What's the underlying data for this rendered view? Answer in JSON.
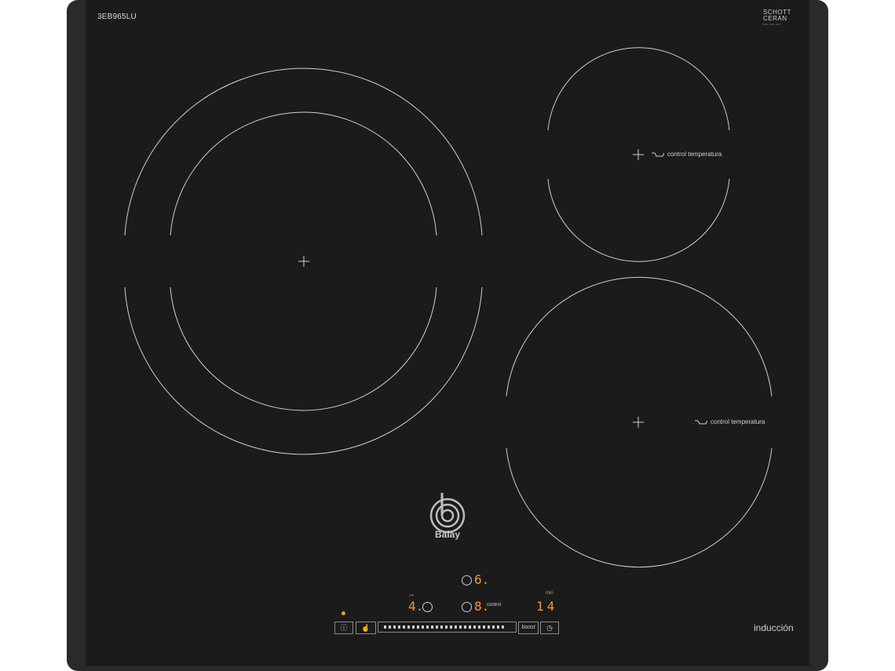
{
  "header": {
    "model": "3EB965LU"
  },
  "glass_brand": {
    "line1": "SCHOTT",
    "line2": "CERAN",
    "fine_print": "800-000-000"
  },
  "footer": {
    "type_label": "inducción"
  },
  "zones": {
    "large": {
      "name": "left"
    },
    "top_right": {
      "label": "control temperatura"
    },
    "bottom_right": {
      "label": "control temperatura"
    }
  },
  "brand": {
    "name": "Balay"
  },
  "panel": {
    "zone_top_level": "6.",
    "zone_left_level": "4.",
    "zone_center_level": "8.",
    "control_word": "control",
    "timer_value": "14",
    "timer_unit": "min",
    "boost_label": "boost",
    "power_icon": "power-icon",
    "child_lock_icon": "child-lock-icon",
    "timer_icon": "clock-icon"
  },
  "colors": {
    "display": "#f39a2b",
    "glass": "#1b1b1b",
    "line": "#cfcfcf"
  }
}
